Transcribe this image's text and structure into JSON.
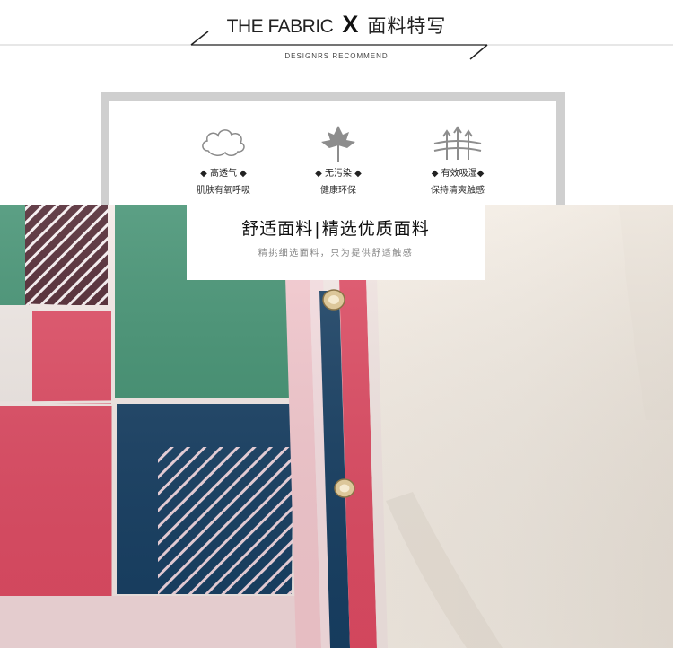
{
  "header": {
    "title_en": "THE FABRIC",
    "title_x": "X",
    "title_cn": "面料特写",
    "subtitle": "DESIGNRS RECOMMEND"
  },
  "features": [
    {
      "icon": "cloud-icon",
      "label": "高透气",
      "desc": "肌肤有氧呼吸"
    },
    {
      "icon": "leaf-icon",
      "label": "无污染",
      "desc": "健康环保"
    },
    {
      "icon": "wheat-icon",
      "label": "有效吸湿",
      "desc": "保持清爽触感"
    }
  ],
  "caption": {
    "title_left": "舒适面料",
    "separator": "|",
    "title_right": "精选优质面料",
    "subtitle": "精挑细选面料，只为提供舒适触感"
  },
  "colors": {
    "green": "#3f8f6f",
    "pink": "#df4b63",
    "navy": "#173f63",
    "maroon": "#4a1f2a",
    "cream": "#f3ede4"
  }
}
